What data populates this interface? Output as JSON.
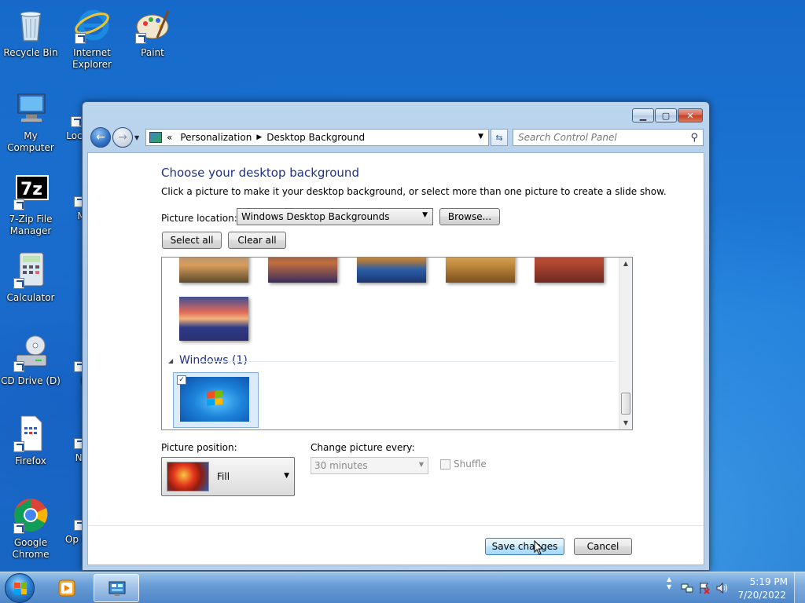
{
  "desktop": {
    "icons": [
      {
        "label": "Recycle Bin"
      },
      {
        "label": "Internet Explorer"
      },
      {
        "label": "Paint"
      },
      {
        "label": "My Computer"
      },
      {
        "label": "Loca"
      },
      {
        "label": "7-Zip File Manager"
      },
      {
        "label": "Mi"
      },
      {
        "label": "Calculator"
      },
      {
        "label": "CD Drive (D)"
      },
      {
        "label": "N"
      },
      {
        "label": "Firefox"
      },
      {
        "label": "No"
      },
      {
        "label": "Google Chrome"
      },
      {
        "label": "Op B"
      }
    ]
  },
  "window": {
    "address": {
      "chevron": "«",
      "crumb1": "Personalization",
      "crumb2": "Desktop Background"
    },
    "search_placeholder": "Search Control Panel",
    "heading": "Choose your desktop background",
    "subtext": "Click a picture to make it your desktop background, or select more than one picture to create a slide show.",
    "picture_location_label": "Picture location:",
    "picture_location_value": "Windows Desktop Backgrounds",
    "browse_label": "Browse...",
    "select_all_label": "Select all",
    "clear_all_label": "Clear all",
    "group_label": "Windows (1)",
    "picture_position_label": "Picture position:",
    "picture_position_value": "Fill",
    "change_every_label": "Change picture every:",
    "change_every_value": "30 minutes",
    "shuffle_label": "Shuffle",
    "save_label": "Save changes",
    "cancel_label": "Cancel"
  },
  "taskbar": {
    "time": "5:19 PM",
    "date": "7/20/2022"
  }
}
